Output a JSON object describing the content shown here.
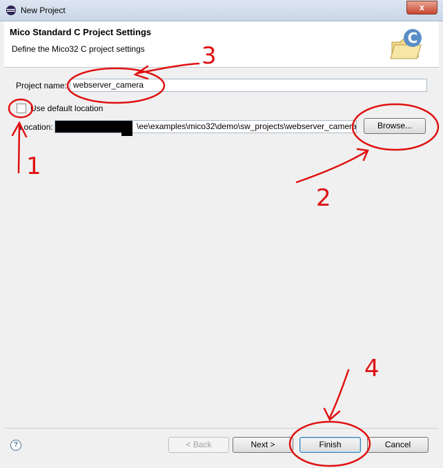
{
  "window": {
    "title": "New Project",
    "close_label": "x"
  },
  "header": {
    "title": "Mico Standard C Project Settings",
    "description": "Define the Mico32 C project settings"
  },
  "form": {
    "project_name_label": "Project name:",
    "project_name_value": "webserver_camera",
    "default_location_label": "Use default location",
    "default_location_checked": false,
    "location_label": "Location:",
    "location_value": "\\ee\\examples\\mico32\\demo\\sw_projects\\webserver_camera",
    "browse_label": "Browse..."
  },
  "footer": {
    "help_label": "?",
    "back_label": "< Back",
    "next_label": "Next >",
    "finish_label": "Finish",
    "cancel_label": "Cancel"
  },
  "annotations": {
    "n1": "1",
    "n2": "2",
    "n3": "3",
    "n4": "4"
  },
  "colors": {
    "annotation": "#e01010",
    "accent": "#3c7fb1"
  }
}
